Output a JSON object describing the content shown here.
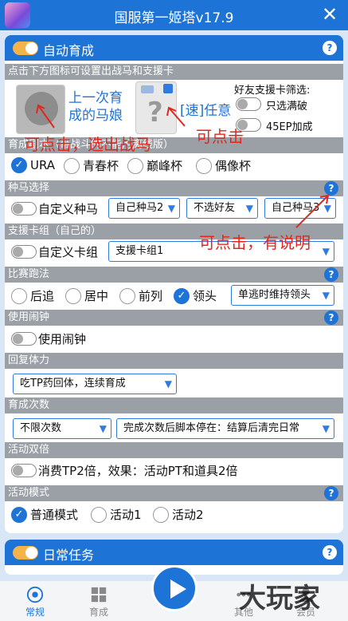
{
  "titlebar": {
    "title": "国服第一姬塔v17.9",
    "close": "✕"
  },
  "auto_train": {
    "header": "自动育成",
    "hint_bar": "点击下方图标可设置出战马和支援卡",
    "last_horse": "上一次育成的马娘",
    "speed_label": "[速]任意",
    "friend_filter_title": "好友支援卡筛选:",
    "only_full": "只选满破",
    "ep_bonus": "45EP加成",
    "scenario_bar": "育成剧本（带战斗的不能用离线版）",
    "scenarios": [
      "URA",
      "青春杯",
      "巅峰杯",
      "偶像杯"
    ],
    "scenario_selected": 0,
    "breed_bar": "种马选择",
    "custom_breed": "自定义种马",
    "breed_selects": [
      "自己种马2",
      "不选好友",
      "自己种马3"
    ],
    "card_bar": "支援卡组（自己的）",
    "custom_card": "自定义卡组",
    "card_select": "支援卡组1",
    "race_bar": "比赛跑法",
    "race_styles": [
      "后追",
      "居中",
      "前列",
      "领头"
    ],
    "race_selected": 3,
    "race_select": "单逃时维持领头",
    "alarm_bar": "使用闹钟",
    "alarm_label": "使用闹钟",
    "stamina_bar": "回复体力",
    "stamina_select": "吃TP药回体，连续育成",
    "count_bar": "育成次数",
    "count_select": "不限次数",
    "after_select": "完成次数后脚本停在：结算后清完日常",
    "double_bar": "活动双倍",
    "double_label": "消费TP2倍，效果：活动PT和道具2倍",
    "mode_bar": "活动模式",
    "modes": [
      "普通模式",
      "活动1",
      "活动2"
    ],
    "mode_selected": 0
  },
  "daily": {
    "header": "日常任务"
  },
  "annotations": {
    "tap_select_horse": "可点击，选出战马",
    "tap": "可点击",
    "tap_has_desc": "可点击，有说明"
  },
  "nav": {
    "items": [
      "常规",
      "育成",
      "其他",
      "会员"
    ]
  },
  "watermark": "大玩家",
  "colors": {
    "primary": "#1e73d6",
    "toggle_on": "#f5b34a",
    "section": "#9aa0a6",
    "annotation": "#e0281e"
  }
}
